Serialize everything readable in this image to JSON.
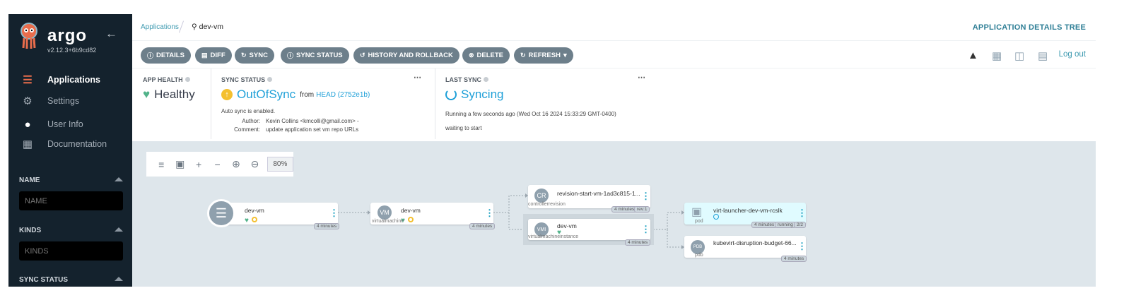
{
  "sidebar": {
    "brand": "argo",
    "version": "v2.12.3+6b9cd82",
    "nav": [
      {
        "label": "Applications",
        "icon": "layers-icon"
      },
      {
        "label": "Settings",
        "icon": "gears-icon"
      },
      {
        "label": "User Info",
        "icon": "user-icon"
      },
      {
        "label": "Documentation",
        "icon": "book-icon"
      }
    ],
    "filters": [
      {
        "label": "NAME",
        "placeholder": "NAME"
      },
      {
        "label": "KINDS",
        "placeholder": "KINDS"
      },
      {
        "label": "SYNC STATUS"
      }
    ]
  },
  "header": {
    "breadcrumb": "Applications",
    "current": "dev-vm",
    "title": "APPLICATION DETAILS TREE"
  },
  "toolbar": {
    "buttons": [
      "DETAILS",
      "DIFF",
      "SYNC",
      "SYNC STATUS",
      "HISTORY AND ROLLBACK",
      "DELETE",
      "REFRESH"
    ],
    "logout": "Log out"
  },
  "status": {
    "health": {
      "label": "APP HEALTH",
      "value": "Healthy"
    },
    "sync": {
      "label": "SYNC STATUS",
      "value": "OutOfSync",
      "from": "from",
      "rev": "HEAD (2752e1b)",
      "auto": "Auto sync is enabled.",
      "author_label": "Author:",
      "author": "Kevin Collins <kmcolli@gmail.com> -",
      "comment_label": "Comment:",
      "comment": "update application set vm repo URLs"
    },
    "last": {
      "label": "LAST SYNC",
      "value": "Syncing",
      "running": "Running a few seconds ago (Wed Oct 16 2024 15:33:29 GMT-0400)",
      "msg": "waiting to start"
    }
  },
  "graph": {
    "zoom": "80%",
    "nodes": {
      "app": {
        "name": "dev-vm",
        "age": "4 minutes"
      },
      "vm": {
        "abbr": "VM",
        "name": "dev-vm",
        "kind": "virtualmachine",
        "age": "4 minutes"
      },
      "cr": {
        "abbr": "CR",
        "name": "revision-start-vm-1ad3c815-1...",
        "kind": "controllerrevision",
        "age": "4 minutes",
        "rev": "rev:1"
      },
      "vmi": {
        "abbr": "VMI",
        "name": "dev-vm",
        "kind": "virtualmachineinstance",
        "age": "4 minutes"
      },
      "pod": {
        "name": "virt-launcher-dev-vm-rcslk",
        "kind": "pod",
        "age": "4 minutes",
        "state": "running",
        "ready": "2/2"
      },
      "pdb": {
        "abbr": "PDB",
        "name": "kubevirt-disruption-budget-66...",
        "kind": "pdb",
        "age": "4 minutes"
      }
    }
  }
}
